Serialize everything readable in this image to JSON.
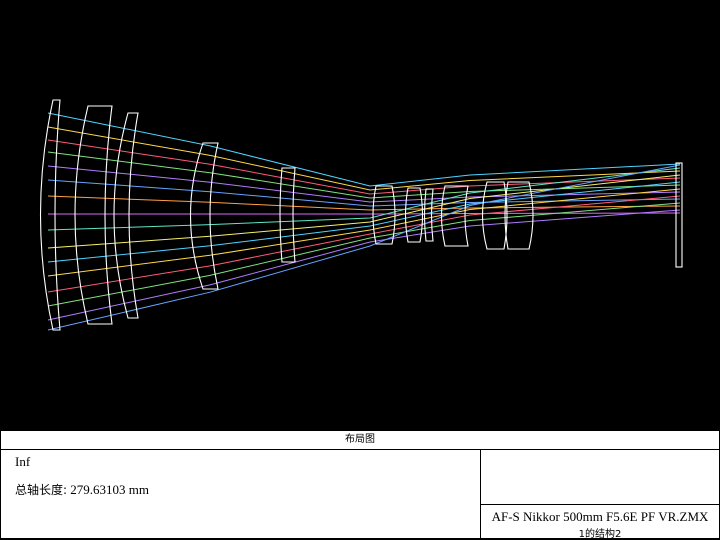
{
  "panel": {
    "title": "布局图",
    "field": "Inf",
    "axis_label": "总轴长度:",
    "axis_value": "279.63103 mm",
    "file_name": "AF-S Nikkor 500mm F5.6E PF VR.ZMX",
    "config": "1的结构2"
  },
  "ray_colors": [
    "#4fd3ff",
    "#ffd84a",
    "#ff5a7a",
    "#7fe27f",
    "#b07cff",
    "#66a3ff",
    "#ff9f43",
    "#e066ff",
    "#5ee6c5",
    "#f5f06b"
  ],
  "lens_color": "#ffffff"
}
